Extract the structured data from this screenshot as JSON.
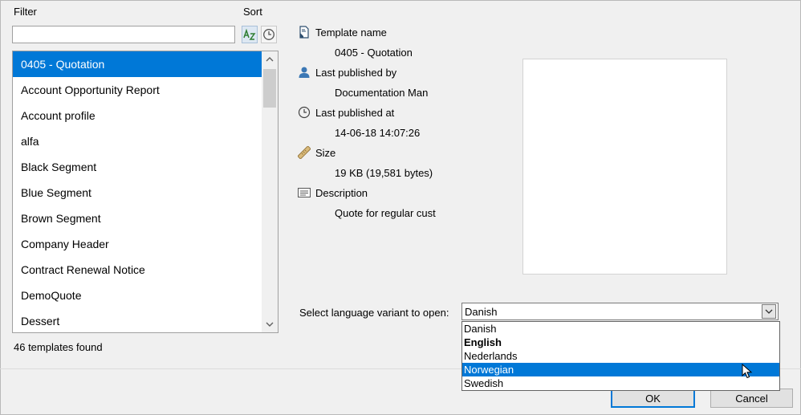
{
  "filter": {
    "label": "Filter",
    "value": "",
    "placeholder": ""
  },
  "sort": {
    "label": "Sort",
    "az_icon": "sort-az-icon",
    "time_icon": "clock-icon"
  },
  "templates": {
    "items": [
      "0405 - Quotation",
      "Account Opportunity Report",
      "Account profile",
      "alfa",
      "Black Segment",
      "Blue Segment",
      "Brown Segment",
      "Company Header",
      "Contract Renewal Notice",
      "DemoQuote",
      "Dessert"
    ],
    "selected_index": 0,
    "count_text": "46 templates found"
  },
  "properties": {
    "template_name": {
      "label": "Template name",
      "value": "0405 - Quotation"
    },
    "published_by": {
      "label": "Last published by",
      "value": "Documentation Man"
    },
    "published_at": {
      "label": "Last published at",
      "value": "14-06-18 14:07:26"
    },
    "size": {
      "label": "Size",
      "value": "19 KB (19,581 bytes)"
    },
    "description": {
      "label": "Description",
      "value": "Quote for regular cust"
    }
  },
  "language": {
    "label": "Select language variant to open:",
    "selected": "Danish",
    "options": [
      "Danish",
      "English",
      "Nederlands",
      "Norwegian",
      "Swedish"
    ],
    "bold_index": 1,
    "highlight_index": 3
  },
  "buttons": {
    "ok": "OK",
    "cancel": "Cancel"
  },
  "colors": {
    "selection": "#0078d7"
  }
}
